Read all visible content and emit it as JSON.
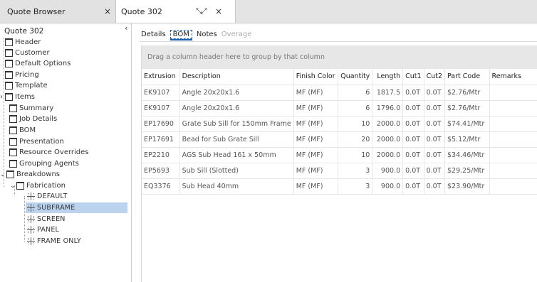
{
  "tabs": {
    "browser": {
      "label": "Quote Browser",
      "close": "×"
    },
    "quote": {
      "label": "Quote 302",
      "maximize": "⤡⤢",
      "close": "×"
    }
  },
  "tree": {
    "title": "Quote 302",
    "collapse": "‹",
    "nodes": [
      {
        "label": "Header"
      },
      {
        "label": "Customer"
      },
      {
        "label": "Default Options"
      },
      {
        "label": "Pricing"
      },
      {
        "label": "Template"
      },
      {
        "label": "Items"
      },
      {
        "label": "Summary"
      },
      {
        "label": "Job Details"
      },
      {
        "label": "BOM"
      },
      {
        "label": "Presentation"
      },
      {
        "label": "Resource Overrides"
      },
      {
        "label": "Grouping Agents"
      },
      {
        "label": "Breakdowns"
      },
      {
        "label": "Fabrication"
      },
      {
        "label": "DEFAULT"
      },
      {
        "label": "SUBFRAME"
      },
      {
        "label": "SCREEN"
      },
      {
        "label": "PANEL"
      },
      {
        "label": "FRAME ONLY"
      }
    ]
  },
  "subtabs": [
    "Details",
    "BOM",
    "Notes",
    "Overage"
  ],
  "grid": {
    "group_hint": "Drag a column header here to group by that column",
    "columns": [
      "Extrusion",
      "Description",
      "Finish Color",
      "Quantity",
      "Length",
      "Cut1",
      "Cut2",
      "Part Code",
      "Remarks"
    ],
    "rows": [
      [
        "EK9107",
        "Angle 20x20x1.6",
        "MF (MF)",
        "6",
        "1817.5",
        "0.0T",
        "0.0T",
        "$2.76/Mtr",
        ""
      ],
      [
        "EK9107",
        "Angle 20x20x1.6",
        "MF (MF)",
        "6",
        "1796.0",
        "0.0T",
        "0.0T",
        "$2.76/Mtr",
        ""
      ],
      [
        "EP17690",
        "Grate Sub Sill for 150mm Frame",
        "MF (MF)",
        "10",
        "2000.0",
        "0.0T",
        "0.0T",
        "$74.41/Mtr",
        ""
      ],
      [
        "EP17691",
        "Bead for Sub Grate Sill",
        "MF (MF)",
        "20",
        "2000.0",
        "0.0T",
        "0.0T",
        "$5.12/Mtr",
        ""
      ],
      [
        "EP2210",
        "AGS Sub Head 161 x 50mm",
        "MF (MF)",
        "10",
        "2000.0",
        "0.0T",
        "0.0T",
        "$34.46/Mtr",
        ""
      ],
      [
        "EP5693",
        "Sub Sill (Slotted)",
        "MF (MF)",
        "3",
        "900.0",
        "0.0T",
        "0.0T",
        "$29.25/Mtr",
        ""
      ],
      [
        "EQ3376",
        "Sub Head 40mm",
        "MF (MF)",
        "3",
        "900.0",
        "0.0T",
        "0.0T",
        "$23.90/Mtr",
        ""
      ]
    ]
  },
  "colors": {
    "selection": "#bcd3ef",
    "accent": "#1a5fb4",
    "group_bar": "#e7e7e7"
  }
}
